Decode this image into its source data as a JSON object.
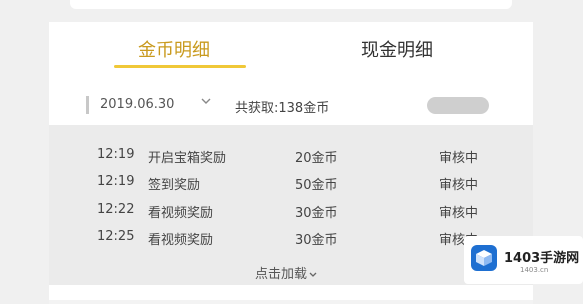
{
  "tabs": [
    {
      "label": "金币明细",
      "active": true
    },
    {
      "label": "现金明细",
      "active": false
    }
  ],
  "summary": {
    "date": "2019.06.30",
    "earned": "共获取:138金币",
    "button_label": ""
  },
  "records": [
    {
      "time": "12:19",
      "description": "开启宝箱奖励",
      "amount": "20金币",
      "status": "审核中"
    },
    {
      "time": "12:19",
      "description": "签到奖励",
      "amount": "50金币",
      "status": "审核中"
    },
    {
      "time": "12:22",
      "description": "看视频奖励",
      "amount": "30金币",
      "status": "审核中"
    },
    {
      "time": "12:25",
      "description": "看视频奖励",
      "amount": "30金币",
      "status": "审核中"
    }
  ],
  "load_more": "点击加载",
  "watermark": {
    "brand": "1403手游网",
    "url": "1403.cn"
  },
  "colors": {
    "accent": "#f0c838",
    "active_tab_text": "#c99a1e",
    "details_bg": "#ebebeb",
    "page_bg": "#f0f0f0",
    "watermark_blue": "#1e6fd1"
  },
  "icons": [
    "chevron-down-icon",
    "watermark-logo-icon"
  ]
}
